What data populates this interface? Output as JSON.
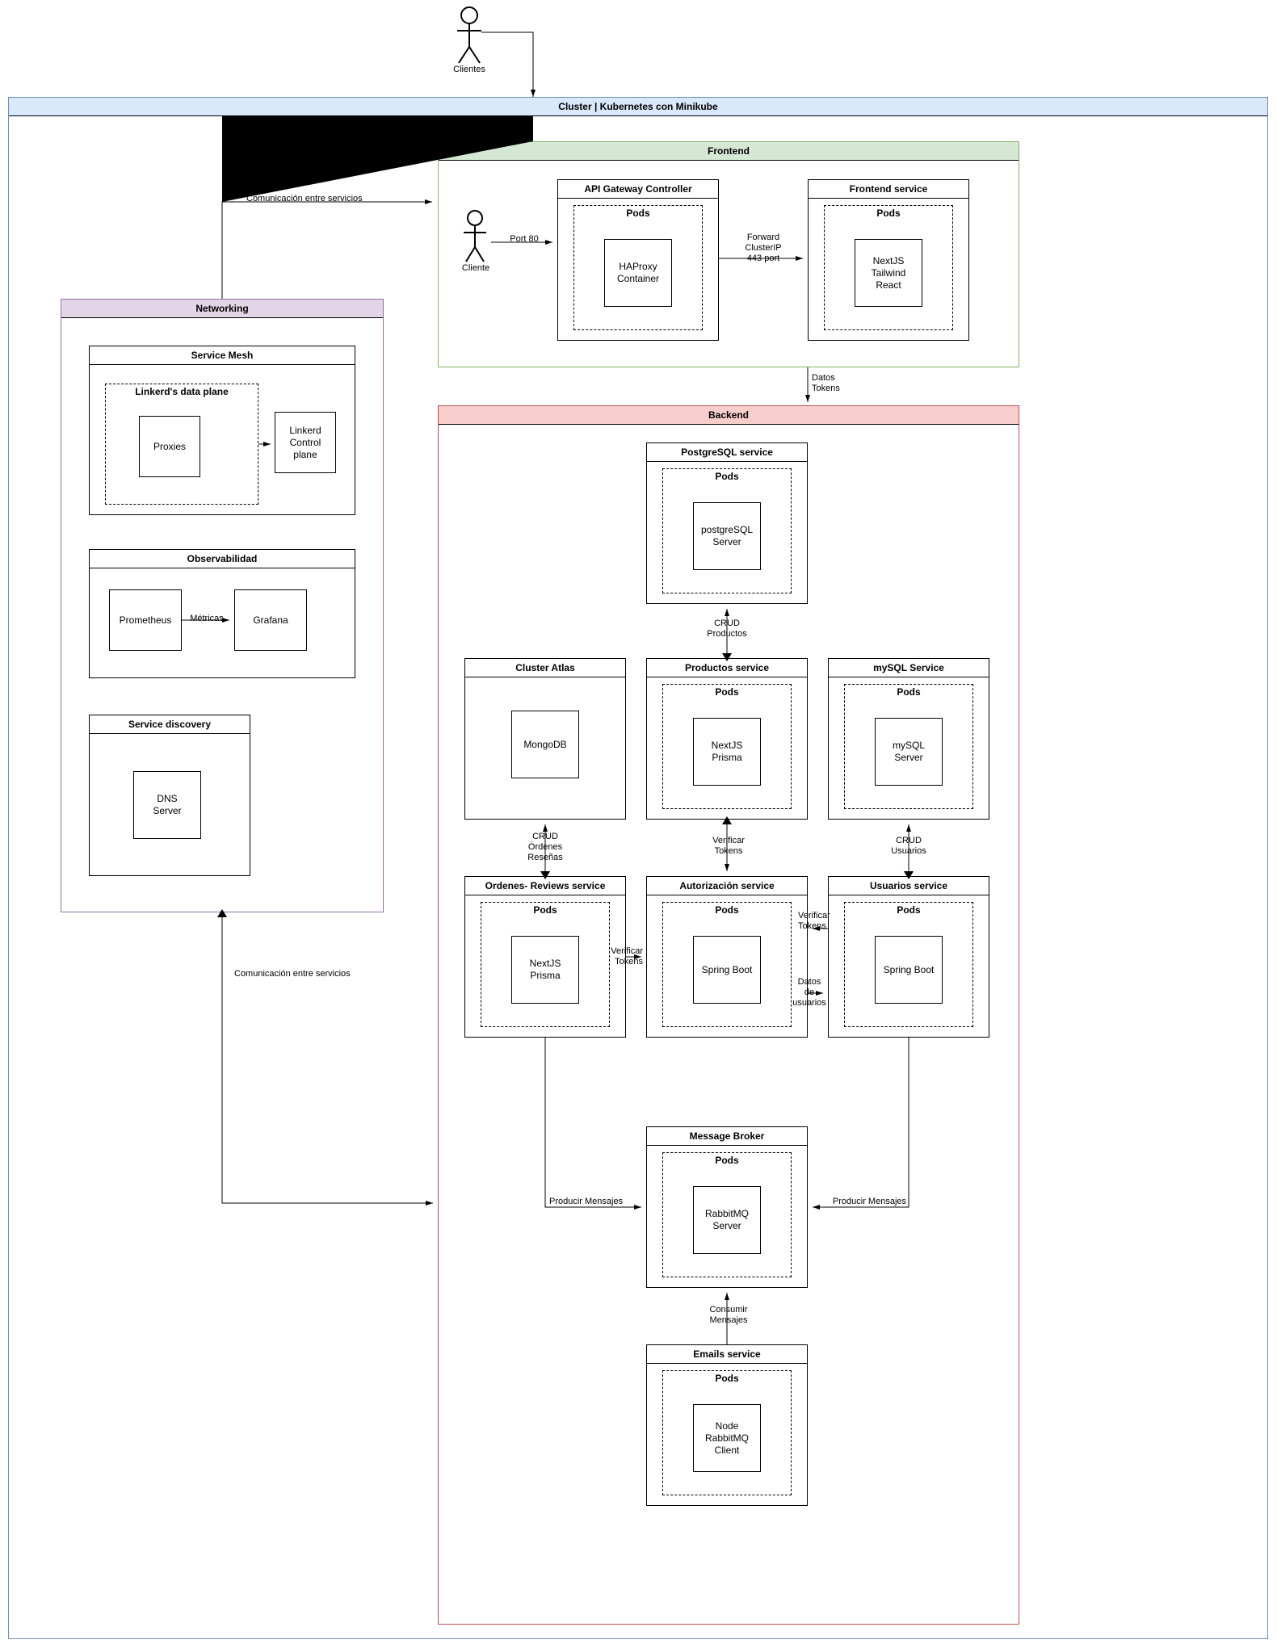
{
  "actors": {
    "clientes_top": "Clientes",
    "cliente_frontend": "Cliente"
  },
  "cluster": {
    "title": "Cluster | Kubernetes con Minikube"
  },
  "frontend": {
    "title": "Frontend",
    "api_gateway": {
      "title": "API Gateway Controller",
      "pods": "Pods",
      "container": "HAProxy\nContainer"
    },
    "frontend_service": {
      "title": "Frontend service",
      "pods": "Pods",
      "container": "NextJS\nTailwind\nReact"
    }
  },
  "networking": {
    "title": "Networking",
    "service_mesh": {
      "title": "Service Mesh",
      "data_plane": "Linkerd's data plane",
      "proxies": "Proxies",
      "control_plane": "Linkerd\nControl\nplane"
    },
    "observability": {
      "title": "Observabilidad",
      "prometheus": "Prometheus",
      "grafana": "Grafana"
    },
    "service_discovery": {
      "title": "Service discovery",
      "dns": "DNS\nServer"
    }
  },
  "backend": {
    "title": "Backend",
    "postgres": {
      "title": "PostgreSQL service",
      "pods": "Pods",
      "container": "postgreSQL\nServer"
    },
    "cluster_atlas": {
      "title": "Cluster Atlas",
      "container": "MongoDB"
    },
    "productos": {
      "title": "Productos service",
      "pods": "Pods",
      "container": "NextJS\nPrisma"
    },
    "mysql": {
      "title": "mySQL Service",
      "pods": "Pods",
      "container": "mySQL\nServer"
    },
    "ordenes": {
      "title": "Ordenes- Reviews service",
      "pods": "Pods",
      "container": "NextJS\nPrisma"
    },
    "autorizacion": {
      "title": "Autorización service",
      "pods": "Pods",
      "container": "Spring Boot"
    },
    "usuarios": {
      "title": "Usuarios service",
      "pods": "Pods",
      "container": "Spring Boot"
    },
    "broker": {
      "title": "Message Broker",
      "pods": "Pods",
      "container": "RabbitMQ\nServer"
    },
    "emails": {
      "title": "Emails service",
      "pods": "Pods",
      "container": "Node\nRabbitMQ\nClient"
    }
  },
  "edges": {
    "port80": "Port 80",
    "forward": "Forward\nClusterIP\n443 port",
    "com_servicios_top": "Comunicación entre servicios",
    "com_servicios_bottom": "Comunicación entre servicios",
    "datos_tokens": "Datos\nTokens",
    "crud_productos": "CRUD\nProductos",
    "crud_ordenes": "CRUD\nÓrdenes\nReseñas",
    "crud_usuarios": "CRUD\nUsuarios",
    "verificar_tokens": "Verificar\nTokens",
    "verificar_tokens2": "Verificar\nTokens",
    "verificar_tokens3": "Verificar\nTokens",
    "datos_usuarios": "Datos\nde\nusuarios",
    "producir_left": "Producir Mensajes",
    "producir_right": "Producir Mensajes",
    "consumir": "Consumir\nMensajes",
    "metricas": "Métricas"
  },
  "colors": {
    "cluster_bg": "#dae8fc",
    "cluster_border": "#6c8ebf",
    "frontend_bg": "#d5e8d4",
    "frontend_border": "#82b366",
    "backend_bg": "#f8cecc",
    "backend_border": "#b85450",
    "networking_bg": "#e1d5e7",
    "networking_border": "#9673a6"
  }
}
